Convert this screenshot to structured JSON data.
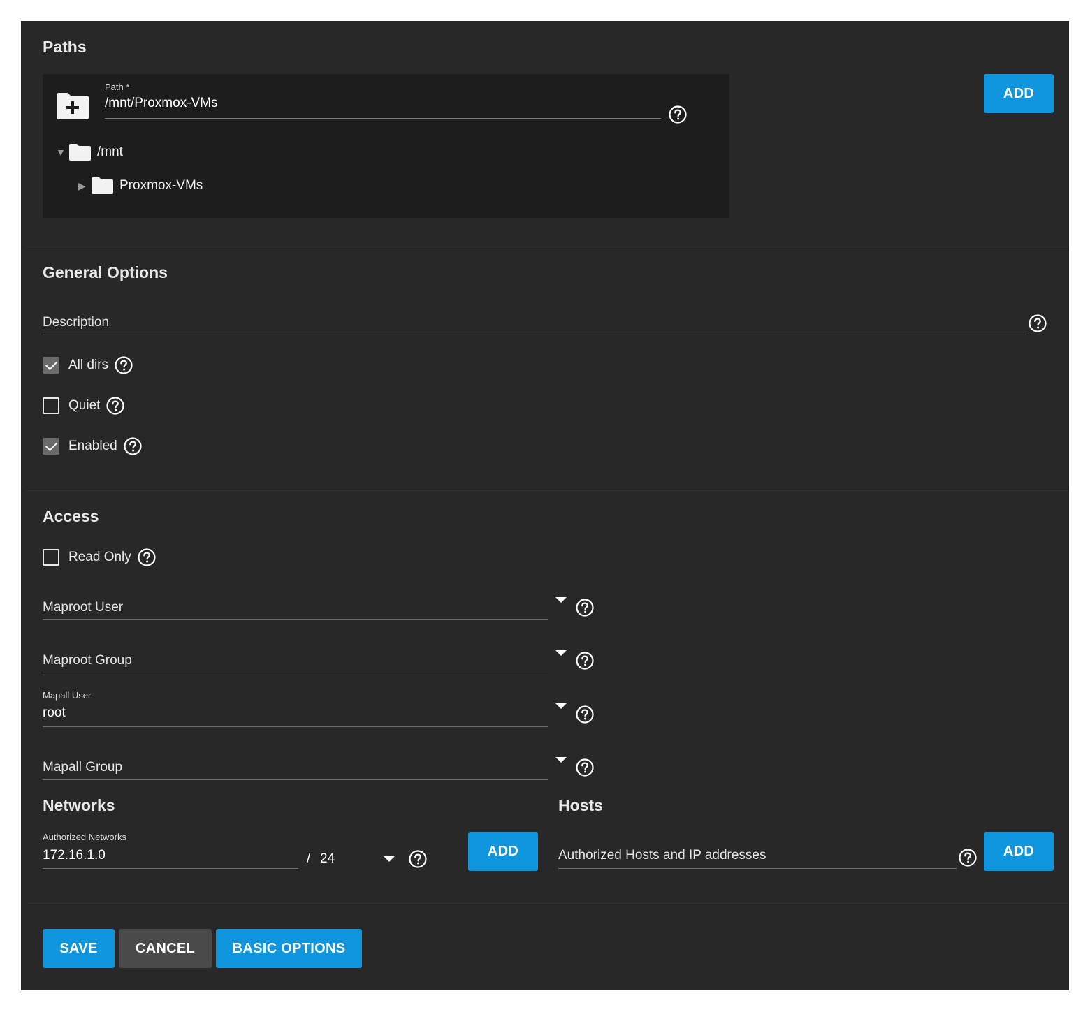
{
  "paths": {
    "title": "Paths",
    "path_label": "Path *",
    "path_value": "/mnt/Proxmox-VMs",
    "tree": [
      {
        "caret": "▼",
        "label": "/mnt"
      },
      {
        "caret": "▶",
        "label": "Proxmox-VMs"
      }
    ],
    "add_label": "ADD"
  },
  "general": {
    "title": "General Options",
    "description_label": "Description",
    "checkboxes": [
      {
        "label": "All dirs",
        "checked": true
      },
      {
        "label": "Quiet",
        "checked": false
      },
      {
        "label": "Enabled",
        "checked": true
      }
    ]
  },
  "access": {
    "title": "Access",
    "read_only_label": "Read Only",
    "read_only_checked": false,
    "maproot_user_label": "Maproot User",
    "maproot_group_label": "Maproot Group",
    "mapall_user_label": "Mapall User",
    "mapall_user_value": "root",
    "mapall_group_label": "Mapall Group"
  },
  "networks": {
    "title": "Networks",
    "field_label": "Authorized Networks",
    "value": "172.16.1.0",
    "separator": "/",
    "mask": "24",
    "add_label": "ADD"
  },
  "hosts": {
    "title": "Hosts",
    "field_label": "Authorized Hosts and IP addresses",
    "add_label": "ADD"
  },
  "actions": {
    "save": "SAVE",
    "cancel": "CANCEL",
    "basic_options": "BASIC OPTIONS"
  },
  "colors": {
    "accent": "#0f95db",
    "panel_bg": "#282828",
    "explorer_bg": "#1d1d1d"
  }
}
